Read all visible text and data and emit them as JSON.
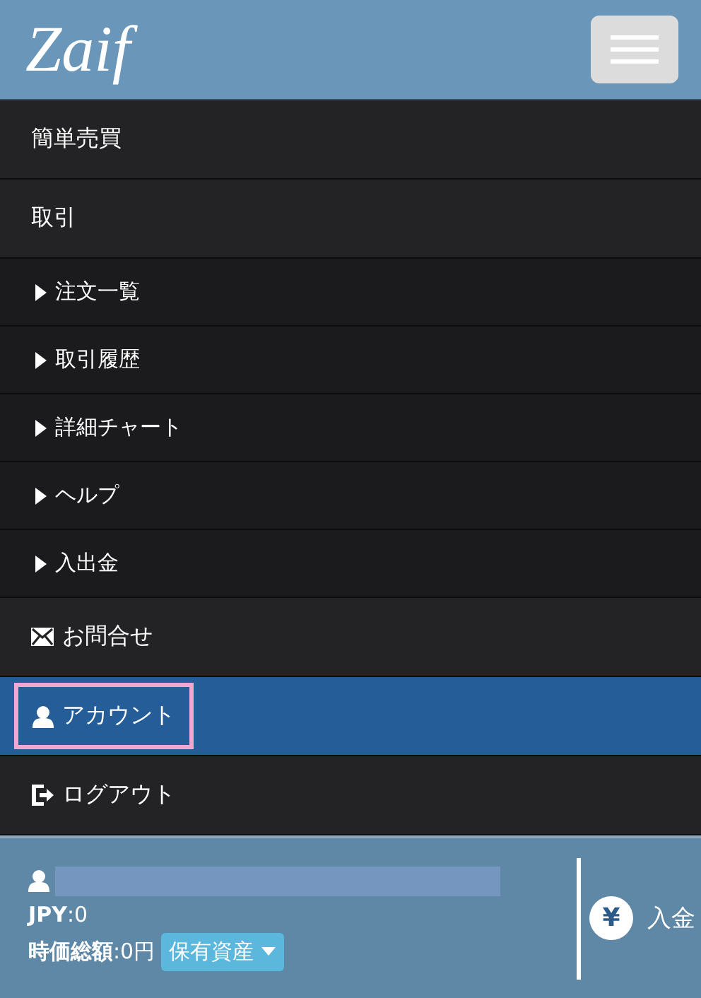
{
  "header": {
    "logo": "Zaif"
  },
  "menu": [
    {
      "label": "簡単売買",
      "kind": "plain",
      "selected": false,
      "highlighted": false
    },
    {
      "label": "取引",
      "kind": "plain",
      "selected": false,
      "highlighted": false
    },
    {
      "label": "注文一覧",
      "kind": "sub",
      "selected": false,
      "highlighted": false
    },
    {
      "label": "取引履歴",
      "kind": "sub",
      "selected": false,
      "highlighted": false
    },
    {
      "label": "詳細チャート",
      "kind": "sub",
      "selected": false,
      "highlighted": false
    },
    {
      "label": "ヘルプ",
      "kind": "sub",
      "selected": false,
      "highlighted": false
    },
    {
      "label": "入出金",
      "kind": "sub",
      "selected": false,
      "highlighted": false
    },
    {
      "label": "お問合せ",
      "kind": "contact",
      "selected": false,
      "highlighted": false
    },
    {
      "label": "アカウント",
      "kind": "account",
      "selected": true,
      "highlighted": true
    },
    {
      "label": "ログアウト",
      "kind": "logout",
      "selected": false,
      "highlighted": false
    }
  ],
  "footer": {
    "balance": "**JPY**:0",
    "total": "**時価総額**:0円",
    "assets_button": "保有資産",
    "deposit_icon": "¥",
    "deposit_label": "入金"
  }
}
